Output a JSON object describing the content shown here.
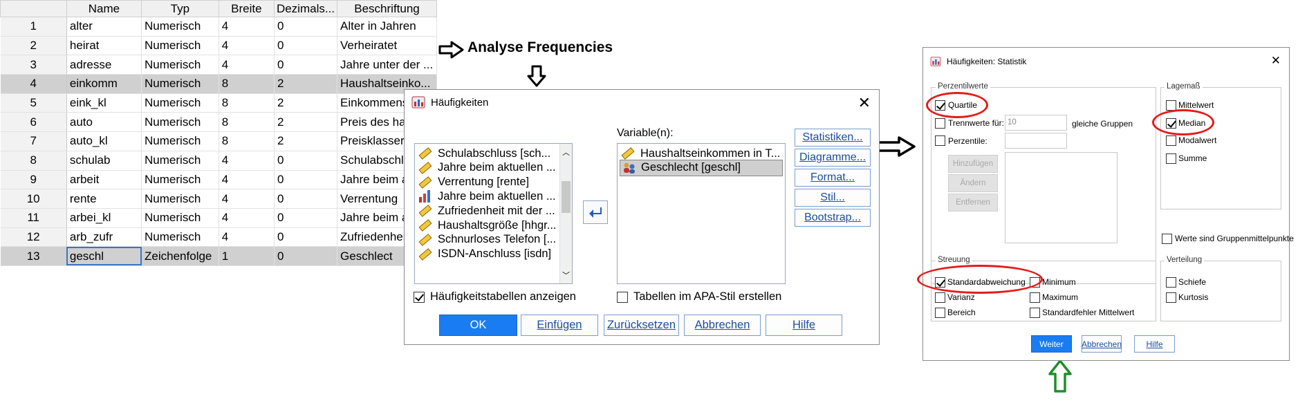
{
  "grid": {
    "headers": [
      "",
      "Name",
      "Typ",
      "Breite",
      "Dezimals...",
      "Beschriftung"
    ],
    "rows": [
      {
        "n": "1",
        "name": "alter",
        "typ": "Numerisch",
        "breite": "4",
        "dez": "0",
        "label": "Alter in Jahren"
      },
      {
        "n": "2",
        "name": "heirat",
        "typ": "Numerisch",
        "breite": "4",
        "dez": "0",
        "label": "Verheiratet"
      },
      {
        "n": "3",
        "name": "adresse",
        "typ": "Numerisch",
        "breite": "4",
        "dez": "0",
        "label": "Jahre unter der ..."
      },
      {
        "n": "4",
        "name": "einkomm",
        "typ": "Numerisch",
        "breite": "8",
        "dez": "2",
        "label": "Haushaltseinko..."
      },
      {
        "n": "5",
        "name": "eink_kl",
        "typ": "Numerisch",
        "breite": "8",
        "dez": "2",
        "label": "Einkommens"
      },
      {
        "n": "6",
        "name": "auto",
        "typ": "Numerisch",
        "breite": "8",
        "dez": "2",
        "label": "Preis des ha"
      },
      {
        "n": "7",
        "name": "auto_kl",
        "typ": "Numerisch",
        "breite": "8",
        "dez": "2",
        "label": "Preisklasser"
      },
      {
        "n": "8",
        "name": "schulab",
        "typ": "Numerisch",
        "breite": "4",
        "dez": "0",
        "label": "Schulabschl"
      },
      {
        "n": "9",
        "name": "arbeit",
        "typ": "Numerisch",
        "breite": "4",
        "dez": "0",
        "label": "Jahre beim a"
      },
      {
        "n": "10",
        "name": "rente",
        "typ": "Numerisch",
        "breite": "4",
        "dez": "0",
        "label": "Verrentung"
      },
      {
        "n": "11",
        "name": "arbei_kl",
        "typ": "Numerisch",
        "breite": "4",
        "dez": "0",
        "label": "Jahre beim a"
      },
      {
        "n": "12",
        "name": "arb_zufr",
        "typ": "Numerisch",
        "breite": "4",
        "dez": "0",
        "label": "Zufriedenheit"
      },
      {
        "n": "13",
        "name": "geschl",
        "typ": "Zeichenfolge",
        "breite": "1",
        "dez": "0",
        "label": "Geschlect"
      }
    ]
  },
  "annotation": {
    "text": "Analyse Frequencies"
  },
  "main_dialog": {
    "title": "Häufigkeiten",
    "source_items": [
      {
        "label": "Schulabschluss [sch...",
        "icon": "scale-ruler-icon"
      },
      {
        "label": "Jahre beim aktuellen ...",
        "icon": "scale-ruler-icon"
      },
      {
        "label": "Verrentung [rente]",
        "icon": "scale-ruler-icon"
      },
      {
        "label": "Jahre beim aktuellen ...",
        "icon": "ordinal-bars-icon"
      },
      {
        "label": "Zufriedenheit mit der ...",
        "icon": "scale-ruler-icon"
      },
      {
        "label": "Haushaltsgröße [hhgr...",
        "icon": "scale-ruler-icon"
      },
      {
        "label": "Schnurloses Telefon [...",
        "icon": "scale-ruler-icon"
      },
      {
        "label": "ISDN-Anschluss [isdn]",
        "icon": "scale-ruler-icon"
      }
    ],
    "variables_label": "Variable(n):",
    "selected_items": [
      {
        "label": "Haushaltseinkommen in T...",
        "icon": "scale-ruler-icon"
      },
      {
        "label": "Geschlecht [geschl]",
        "icon": "nominal-people-icon"
      }
    ],
    "side_buttons": [
      "Statistiken...",
      "Diagramme...",
      "Format...",
      "Stil...",
      "Bootstrap..."
    ],
    "check_freq": "Häufigkeitstabellen anzeigen",
    "check_apa": "Tabellen im APA-Stil erstellen",
    "bottom_buttons": [
      "OK",
      "Einfügen",
      "Zurücksetzen",
      "Abbrechen",
      "Hilfe"
    ]
  },
  "stat_dialog": {
    "title": "Häufigkeiten: Statistik",
    "perzentil": {
      "title": "Perzentilwerte",
      "quartile": "Quartile",
      "trennwerte": "Trennwerte für:",
      "trennwerte_value": "10",
      "gleiche": "gleiche Gruppen",
      "perzentile": "Perzentile:",
      "buttons": [
        "Hinzufügen",
        "Ändern",
        "Entfernen"
      ]
    },
    "lage": {
      "title": "Lagemaß",
      "items": [
        "Mittelwert",
        "Median",
        "Modalwert",
        "Summe"
      ]
    },
    "gruppen": "Werte sind Gruppenmittelpunkte",
    "streuung": {
      "title": "Streuung",
      "items": [
        "Standardabweichung",
        "Minimum",
        "Varianz",
        "Maximum",
        "Bereich",
        "Standardfehler Mittelwert"
      ]
    },
    "verteilung": {
      "title": "Verteilung",
      "items": [
        "Schiefe",
        "Kurtosis"
      ]
    },
    "buttons": [
      "Weiter",
      "Abbrechen",
      "Hilfe"
    ]
  }
}
